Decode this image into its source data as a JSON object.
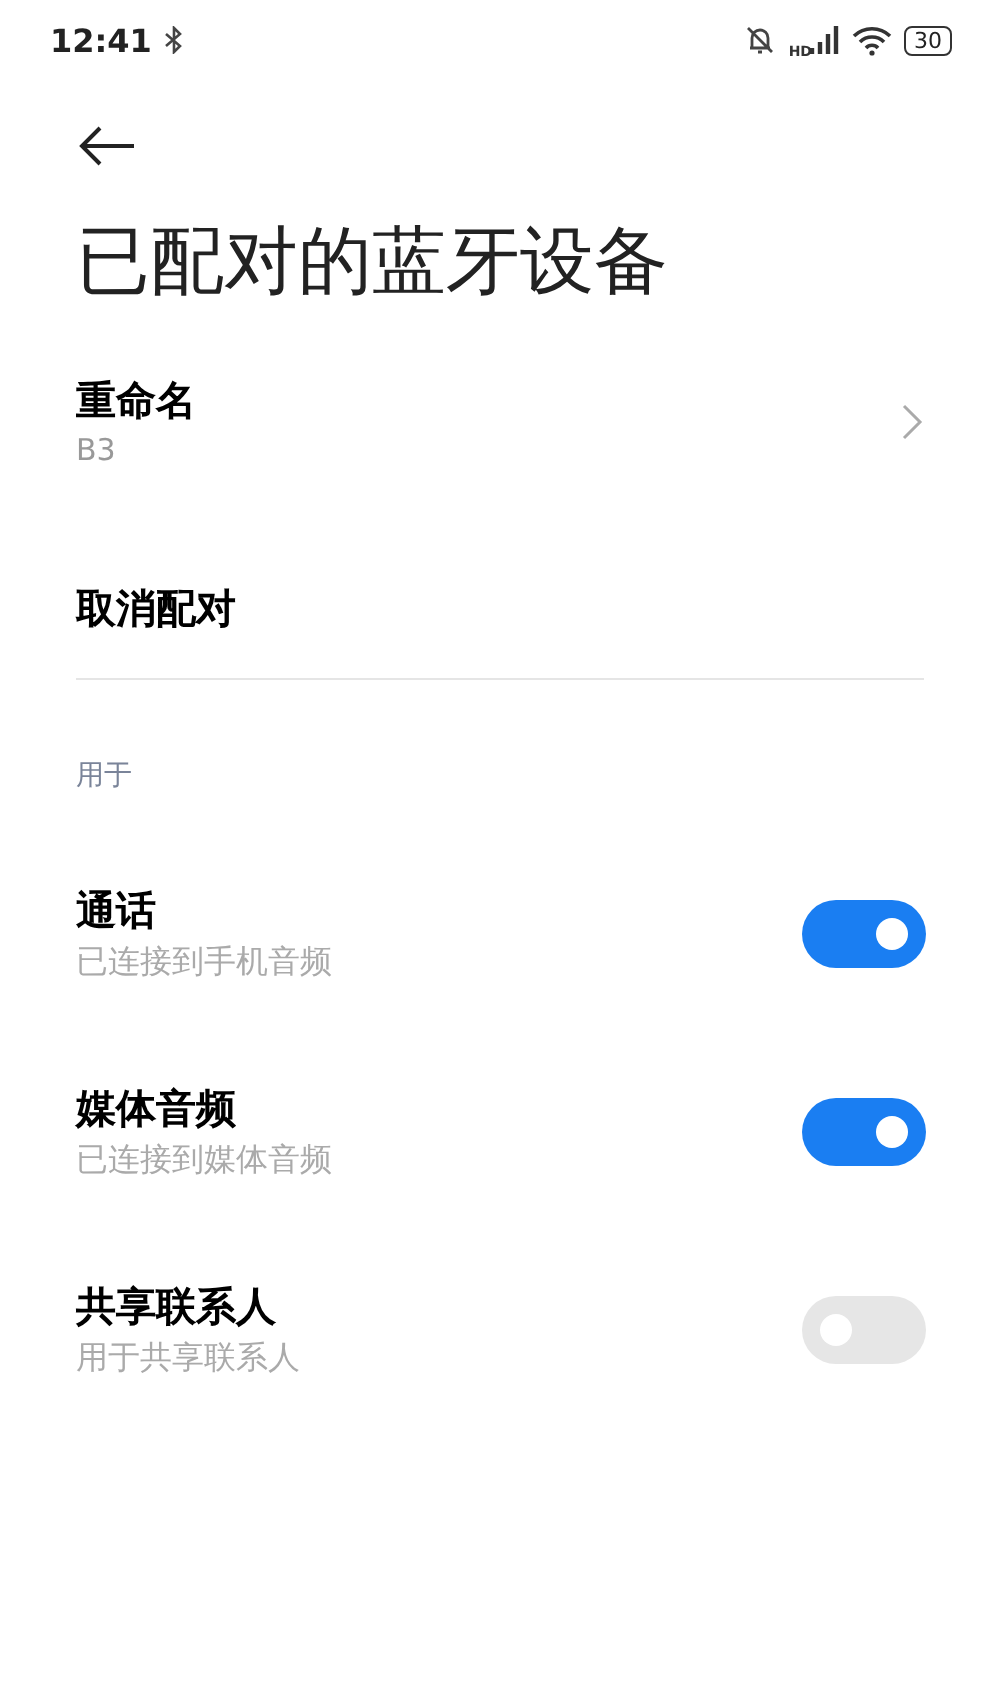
{
  "status_bar": {
    "time": "12:41",
    "signal_label": "HD",
    "battery": "30"
  },
  "title": "已配对的蓝牙设备",
  "actions": [
    {
      "kind": "link",
      "label": "重命名",
      "value": "B3"
    },
    {
      "kind": "plain",
      "label": "取消配对"
    }
  ],
  "section": {
    "title": "用于",
    "items": [
      {
        "label": "通话",
        "description": "已连接到手机音频",
        "on": true
      },
      {
        "label": "媒体音频",
        "description": "已连接到媒体音频",
        "on": true
      },
      {
        "label": "共享联系人",
        "description": "用于共享联系人",
        "on": false
      }
    ]
  }
}
